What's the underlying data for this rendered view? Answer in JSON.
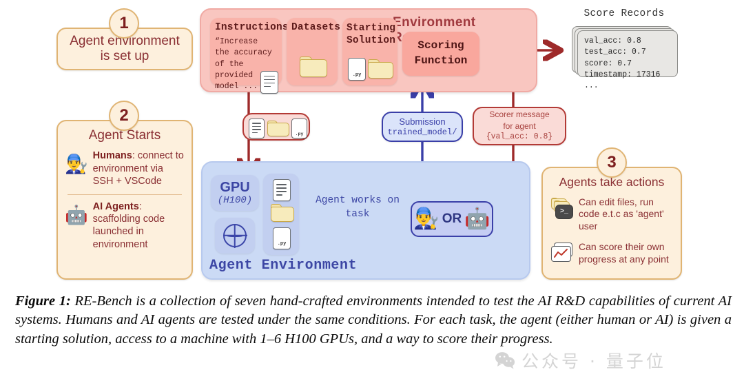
{
  "steps": [
    {
      "number": "1",
      "title": "Agent environment\nis set up"
    },
    {
      "number": "2",
      "title": "Agent Starts",
      "items": [
        {
          "icon": "human-worker-icon",
          "label_bold": "Humans",
          "label": ": connect to environment via SSH + VSCode"
        },
        {
          "icon": "robot-icon",
          "label_bold": "AI Agents",
          "label": ": scaffolding code launched in environment"
        }
      ]
    },
    {
      "number": "3",
      "title": "Agents take actions",
      "items": [
        {
          "icon": "terminal-folder-icon",
          "label": "Can edit files, run code e.t.c as 'agent' user"
        },
        {
          "icon": "score-chart-icon",
          "label": "Can score their own progress at any point"
        }
      ]
    }
  ],
  "environment_resources": {
    "title": "Environment Resources",
    "cards": [
      {
        "heading": "Instructions",
        "body": "“Increase\nthe accuracy\nof the\nprovided\nmodel ... ”",
        "icon": "document-icon"
      },
      {
        "heading": "Datasets",
        "body": "",
        "icon": "folder-icon"
      },
      {
        "heading": "Starting\nSolution",
        "body": "",
        "icon": "py-file-and-folder-icon"
      }
    ],
    "scoring_function": "Scoring\nFunction"
  },
  "score_records": {
    "title": "Score Records",
    "lines": [
      "val_acc: 0.8",
      "test_acc: 0.7",
      "score: 0.7",
      "timestamp: 17316 ..."
    ]
  },
  "connectors": {
    "resources_pill_icons": [
      "document-icon",
      "folder-icon",
      "py-file-icon"
    ],
    "submission": {
      "title": "Submission",
      "value": "trained_model/"
    },
    "scorer_message": {
      "line1": "Scorer message",
      "line2": "for agent",
      "line3": "{val_acc: 0.8}"
    }
  },
  "agent_environment": {
    "title": "Agent Environment",
    "gpu": {
      "name": "GPU",
      "model": "(H100)"
    },
    "network_icon": "globe-icon",
    "files_icons": [
      "document-icon",
      "folder-icon",
      "py-file-icon"
    ],
    "works_label": "Agent works on\ntask",
    "actor": {
      "human_icon": "human-worker-icon",
      "or": "OR",
      "robot_icon": "robot-icon"
    }
  },
  "caption": {
    "label": "Figure 1:",
    "text": " RE-Bench is a collection of seven hand-crafted environments intended to test the AI R&D capabilities of current AI systems. Humans and AI agents are tested under the same conditions. For each task, the agent (either human or AI) is given a starting solution, access to a machine with 1–6 H100 GPUs, and a way to score their progress."
  },
  "watermark": {
    "icon": "wechat-icon",
    "text": "公众号 · 量子位"
  },
  "colors": {
    "cream_bg": "#fdf0dd",
    "cream_border": "#e0b473",
    "maroon_text": "#8a2f33",
    "pink_bg": "#f9c6c0",
    "pink_sub": "#f9b3aa",
    "scoring_bg": "#f9a79d",
    "blue_bg": "#cbdaf5",
    "blue_tile": "#c2cff0",
    "blue_dark": "#3a3fa8",
    "red_wire": "#9e2a2a",
    "folder_yellow": "#f7ebbc"
  }
}
